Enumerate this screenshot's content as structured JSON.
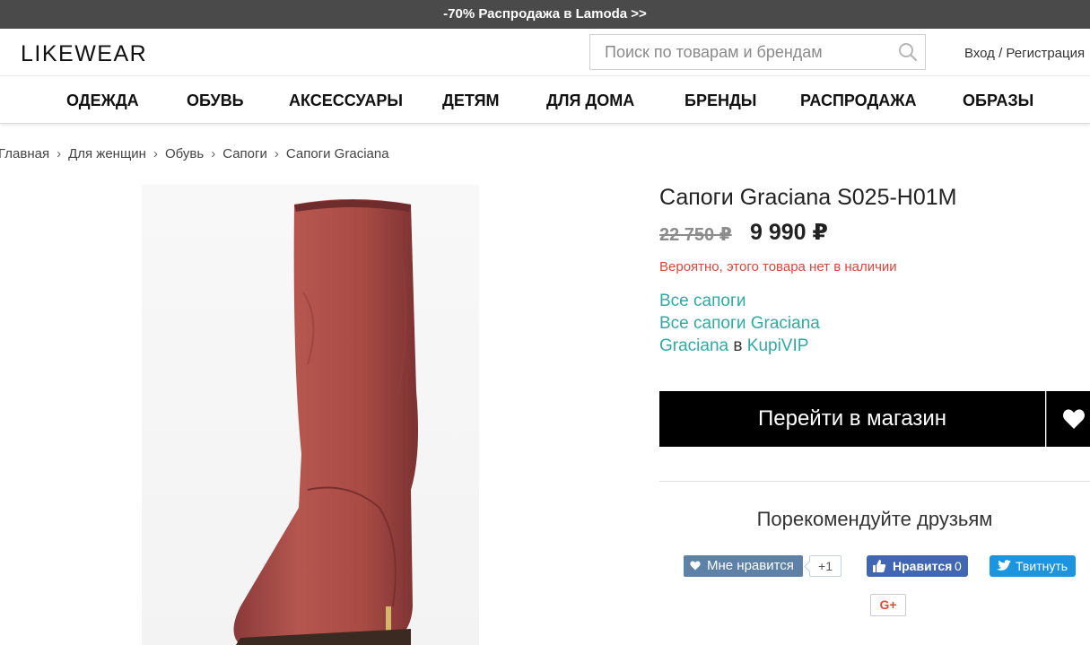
{
  "promo": {
    "text": "-70% Распродажа в Lamoda >>"
  },
  "header": {
    "logo": "LIKEWEAR",
    "search_placeholder": "Поиск по товарам и брендам",
    "login": "Вход / Регистрация"
  },
  "nav": {
    "items": [
      {
        "label": "ОДЕЖДА"
      },
      {
        "label": "ОБУВЬ"
      },
      {
        "label": "АКСЕССУАРЫ"
      },
      {
        "label": "ДЕТЯМ"
      },
      {
        "label": "ДЛЯ ДОМА"
      },
      {
        "label": "БРЕНДЫ"
      },
      {
        "label": "РАСПРОДАЖА"
      },
      {
        "label": "ОБРАЗЫ"
      }
    ]
  },
  "breadcrumb": {
    "items": [
      "Главная",
      "Для женщин",
      "Обувь",
      "Сапоги",
      "Сапоги Graciana"
    ],
    "separator": "›"
  },
  "product": {
    "title": "Сапоги Graciana S025-H01M",
    "old_price": "22 750 ₽",
    "new_price": "9 990 ₽",
    "stock_note": "Вероятно, этого товара нет в наличии",
    "links": {
      "all_boots": "Все сапоги",
      "all_brand_boots": "Все сапоги Graciana",
      "brand": "Graciana",
      "in": "в",
      "store": "KupiVIP"
    },
    "shop_button": "Перейти в магазин",
    "image_icon": "boot-image"
  },
  "share": {
    "title": "Порекомендуйте друзьям",
    "vk_label": "Мне нравится",
    "vk_count": "+1",
    "fb_label": "Нравится",
    "fb_count": "0",
    "tw_label": "Твитнуть",
    "gplus_label": "G+"
  },
  "colors": {
    "promo_bg": "#4a4a4a",
    "link": "#2eaaa5",
    "stock_warning": "#d9463a",
    "shop_button_bg": "#000000",
    "vk": "#5e81a8",
    "facebook": "#4267b2",
    "twitter": "#1b95e0",
    "gplus": "#dd4b39"
  }
}
